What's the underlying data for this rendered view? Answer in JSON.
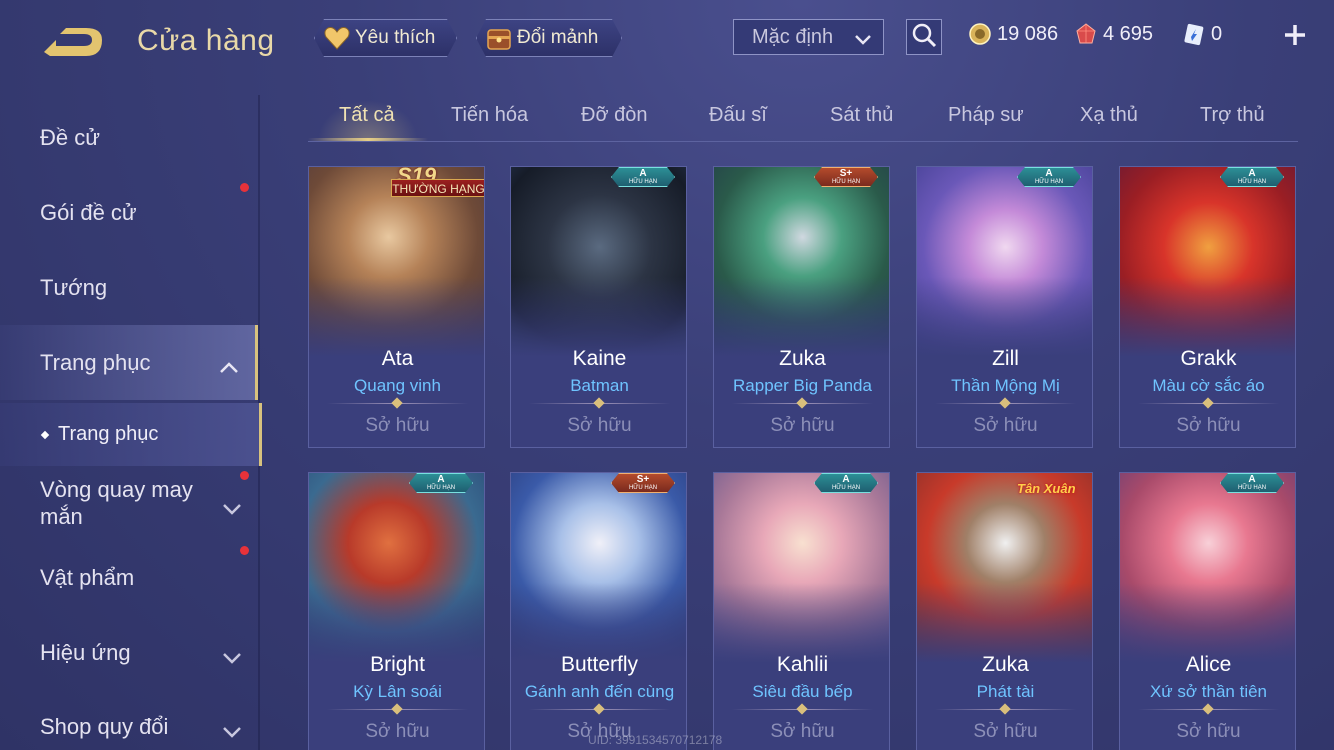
{
  "header": {
    "title": "Cửa hàng",
    "favorite_label": "Yêu thích",
    "trade_label": "Đổi mảnh",
    "sort_value": "Mặc định",
    "currencies": [
      {
        "icon": "gold-coin-icon",
        "value": "19 086"
      },
      {
        "icon": "ruby-gem-icon",
        "value": "4 695"
      },
      {
        "icon": "voucher-icon",
        "value": "0"
      }
    ]
  },
  "sidebar": {
    "items": [
      {
        "label": "Đề cử"
      },
      {
        "label": "Gói đề cử"
      },
      {
        "label": "Tướng"
      },
      {
        "label": "Trang phục"
      },
      {
        "label": "Trang phục"
      },
      {
        "label": "Vòng quay may mắn"
      },
      {
        "label": "Vật phẩm"
      },
      {
        "label": "Hiệu ứng"
      },
      {
        "label": "Shop quy đổi"
      }
    ]
  },
  "tabs": [
    "Tất cả",
    "Tiến hóa",
    "Đỡ đòn",
    "Đấu sĩ",
    "Sát thủ",
    "Pháp sư",
    "Xạ thủ",
    "Trợ thủ"
  ],
  "cards": [
    {
      "hero": "Ata",
      "skin": "Quang vinh",
      "status": "Sở hữu",
      "badge_text": "S19",
      "ribbon": "THƯỜNG HẠNG"
    },
    {
      "hero": "Kaine",
      "skin": "Batman",
      "status": "Sở hữu",
      "badge_rank": "A",
      "badge_sub": "HỮU HẠN"
    },
    {
      "hero": "Zuka",
      "skin": "Rapper Big Panda",
      "status": "Sở hữu",
      "badge_rank": "S+",
      "badge_sub": "HỮU HẠN"
    },
    {
      "hero": "Zill",
      "skin": "Thần Mộng Mị",
      "status": "Sở hữu",
      "badge_rank": "A",
      "badge_sub": "HỮU HẠN"
    },
    {
      "hero": "Grakk",
      "skin": "Màu cờ sắc áo",
      "status": "Sở hữu",
      "badge_rank": "A",
      "badge_sub": "HỮU HẠN"
    },
    {
      "hero": "Bright",
      "skin": "Kỳ Lân soái",
      "status": "Sở hữu",
      "badge_rank": "A",
      "badge_sub": "HỮU HẠN"
    },
    {
      "hero": "Butterfly",
      "skin": "Gánh anh đến cùng",
      "status": "Sở hữu",
      "badge_rank": "S+",
      "badge_sub": "HỮU HẠN"
    },
    {
      "hero": "Kahlii",
      "skin": "Siêu đầu bếp",
      "status": "Sở hữu",
      "badge_rank": "A",
      "badge_sub": "HỮU HẠN"
    },
    {
      "hero": "Zuka",
      "skin": "Phát tài",
      "status": "Sở hữu",
      "event_logo": "Tân Xuân"
    },
    {
      "hero": "Alice",
      "skin": "Xứ sở thần tiên",
      "status": "Sở hữu",
      "badge_rank": "A",
      "badge_sub": "HỮU HẠN"
    }
  ],
  "uid": "UID: 3991534570712178"
}
